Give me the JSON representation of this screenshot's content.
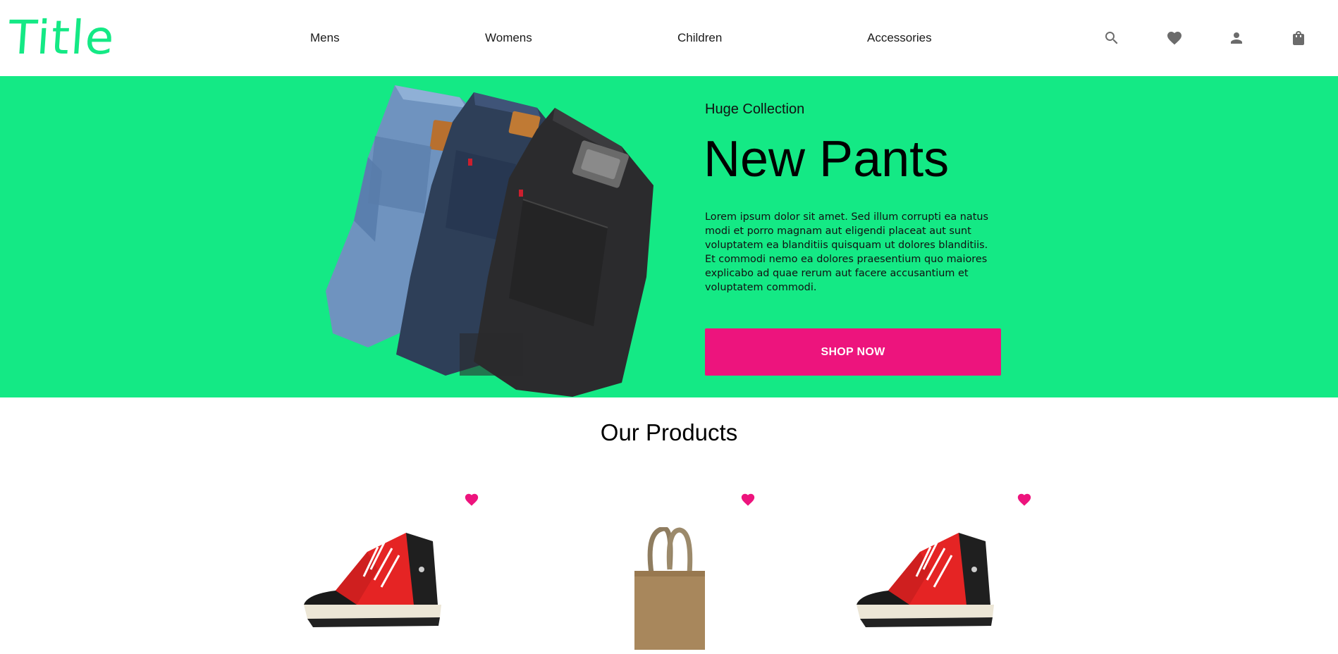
{
  "header": {
    "logo": "Title",
    "nav": [
      "Mens",
      "Womens",
      "Children",
      "Accessories"
    ],
    "icons": [
      "search-icon",
      "heart-icon",
      "user-icon",
      "shopping-bag-icon"
    ]
  },
  "hero": {
    "eyebrow": "Huge Collection",
    "title": "New Pants",
    "description": "Lorem ipsum dolor sit amet. Sed illum corrupti ea natus modi et porro magnam aut eligendi placeat aut sunt voluptatem ea blanditiis quisquam ut dolores blanditiis. Et commodi nemo ea dolores praesentium quo maiores explicabo ad quae rerum aut facere accusantium et voluptatem commodi.",
    "cta": "SHOP NOW"
  },
  "products": {
    "title": "Our Products",
    "items": [
      {
        "image": "sneaker-image",
        "favorite_icon": "heart-icon"
      },
      {
        "image": "tote-bag-image",
        "favorite_icon": "heart-icon"
      },
      {
        "image": "sneaker-image",
        "favorite_icon": "heart-icon"
      }
    ]
  },
  "colors": {
    "brand_green": "#14e985",
    "accent_pink": "#ed147d",
    "icon_gray": "#6b6b6b"
  }
}
